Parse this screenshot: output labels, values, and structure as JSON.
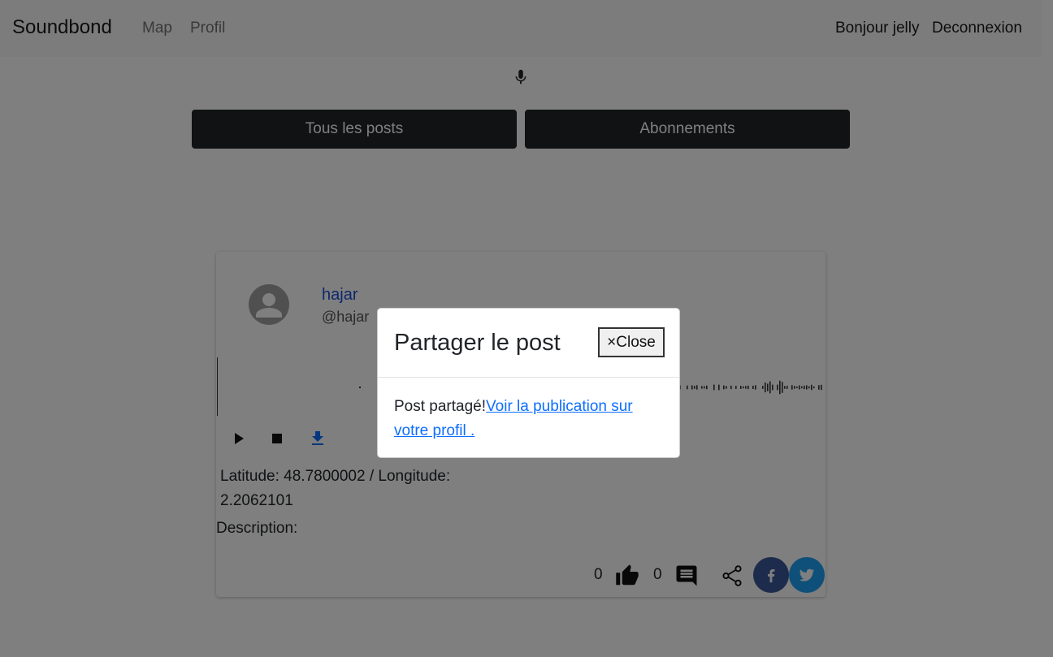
{
  "navbar": {
    "brand": "Soundbond",
    "links": [
      "Map",
      "Profil"
    ],
    "greeting": "Bonjour jelly",
    "logout": "Deconnexion"
  },
  "tabs": [
    "Tous les posts",
    "Abonnements"
  ],
  "post": {
    "username": "hajar",
    "handle": "@hajar",
    "latlon": "Latitude: 48.7800002 / Longitude: 2.2062101",
    "description_label": "Description:",
    "likes": "0",
    "comments": "0"
  },
  "modal": {
    "title": "Partager le post",
    "close_label": "Close",
    "close_symbol": "×",
    "body_text": "Post partagé!",
    "link_text": "Voir la publication sur votre profil ."
  },
  "colors": {
    "dark_button": "#212529",
    "link": "#0d6efd",
    "facebook": "#3b5998",
    "twitter": "#1da1f2"
  }
}
